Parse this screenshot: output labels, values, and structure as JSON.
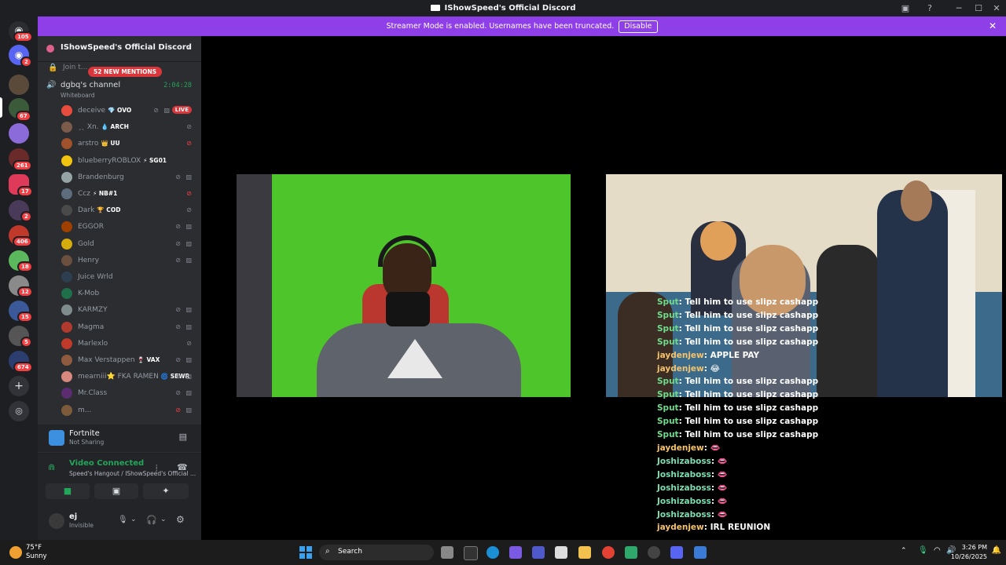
{
  "window": {
    "title": "IShowSpeed's Official Discord"
  },
  "banner": {
    "message": "Streamer Mode is enabled. Usernames have been truncated.",
    "disable_label": "Disable"
  },
  "rail": {
    "badges": [
      "105",
      "2",
      "67",
      "261",
      "17",
      "2",
      "406",
      "18",
      "12",
      "15",
      "5",
      "674"
    ]
  },
  "server": {
    "name": "IShowSpeed's Official Discord"
  },
  "sidebar": {
    "join_label": "Join t...",
    "mentions_label": "52 NEW MENTIONS",
    "voice_channel": {
      "name": "dgbq's channel",
      "timer": "2:04:28",
      "activity": "Whiteboard"
    },
    "members": [
      {
        "name": "deceive",
        "tag": "💎 OVO",
        "live": "LIVE",
        "color": "#e74c3c"
      },
      {
        "name": "ˏˎ Xn.",
        "tag": "💧 ARCH",
        "color": "#7c5b4a"
      },
      {
        "name": "arstro",
        "tag": "👑 UU",
        "color": "#a0522d"
      },
      {
        "name": "blueberryROBLOX",
        "tag": "⚡ SG01",
        "color": "#f1c40f"
      },
      {
        "name": "Brandenburg",
        "tag": "",
        "color": "#95a5a6"
      },
      {
        "name": "Ccz",
        "tag": "⚡ NB#1",
        "color": "#5d6d7e"
      },
      {
        "name": "Dark",
        "tag": "🏆 COD",
        "color": "#4a4a4a"
      },
      {
        "name": "EGGOR",
        "tag": "",
        "color": "#a04000"
      },
      {
        "name": "Gold",
        "tag": "",
        "color": "#d4ac0d"
      },
      {
        "name": "Henry",
        "tag": "",
        "color": "#6b4f3f"
      },
      {
        "name": "Juice Wrld",
        "tag": "",
        "color": "#2c3e50"
      },
      {
        "name": "K-Mob",
        "tag": "",
        "color": "#1f6f4a"
      },
      {
        "name": "KARMZY",
        "tag": "",
        "color": "#7f8c8d"
      },
      {
        "name": "Magma",
        "tag": "",
        "color": "#b03a2e"
      },
      {
        "name": "Marlexlo",
        "tag": "",
        "color": "#c0392b"
      },
      {
        "name": "Max Verstappen",
        "tag": "🍷 VAX",
        "color": "#8e5b3e"
      },
      {
        "name": "mearniii⭐ FKA RAMEN",
        "tag": "🌀 SEWR",
        "color": "#d98880"
      },
      {
        "name": "Mr.Class",
        "tag": "",
        "color": "#5b2c6f"
      },
      {
        "name": "m...",
        "tag": "",
        "color": "#7b5b3a"
      }
    ]
  },
  "activity": {
    "title": "Fortnite",
    "status": "Not Sharing"
  },
  "voice": {
    "status": "Video Connected",
    "location": "Speed's Hangout / IShowSpeed's Official ..."
  },
  "user": {
    "name": "ej",
    "status": "Invisible"
  },
  "chat": [
    {
      "user": "Sput",
      "msg": "Tell him to use slipz cashapp",
      "cls": "u1"
    },
    {
      "user": "Sput",
      "msg": "Tell him to use slipz cashapp",
      "cls": "u1"
    },
    {
      "user": "Sput",
      "msg": "Tell him to use slipz cashapp",
      "cls": "u1"
    },
    {
      "user": "Sput",
      "msg": "Tell him to use slipz cashapp",
      "cls": "u1"
    },
    {
      "user": "jaydenjew",
      "msg": "APPLE PAY",
      "cls": "u2"
    },
    {
      "user": "jaydenjew",
      "msg": "😂",
      "cls": "u2"
    },
    {
      "user": "Sput",
      "msg": "Tell him to use slipz cashapp",
      "cls": "u1"
    },
    {
      "user": "Sput",
      "msg": "Tell him to use slipz cashapp",
      "cls": "u1"
    },
    {
      "user": "Sput",
      "msg": "Tell him to use slipz cashapp",
      "cls": "u1"
    },
    {
      "user": "Sput",
      "msg": "Tell him to use slipz cashapp",
      "cls": "u1"
    },
    {
      "user": "Sput",
      "msg": "Tell him to use slipz cashapp",
      "cls": "u1"
    },
    {
      "user": "jaydenjew",
      "msg": "👄",
      "cls": "u2"
    },
    {
      "user": "Joshizaboss",
      "msg": "👄",
      "cls": "u3"
    },
    {
      "user": "Joshizaboss",
      "msg": "👄",
      "cls": "u3"
    },
    {
      "user": "Joshizaboss",
      "msg": "👄",
      "cls": "u3"
    },
    {
      "user": "Joshizaboss",
      "msg": "👄",
      "cls": "u3"
    },
    {
      "user": "Joshizaboss",
      "msg": "👄",
      "cls": "u3"
    },
    {
      "user": "jaydenjew",
      "msg": "IRL REUNION",
      "cls": "u2"
    }
  ],
  "taskbar": {
    "weather_temp": "75°F",
    "weather_desc": "Sunny",
    "search": "Search",
    "time": "3:26 PM",
    "date": "10/26/2025"
  }
}
